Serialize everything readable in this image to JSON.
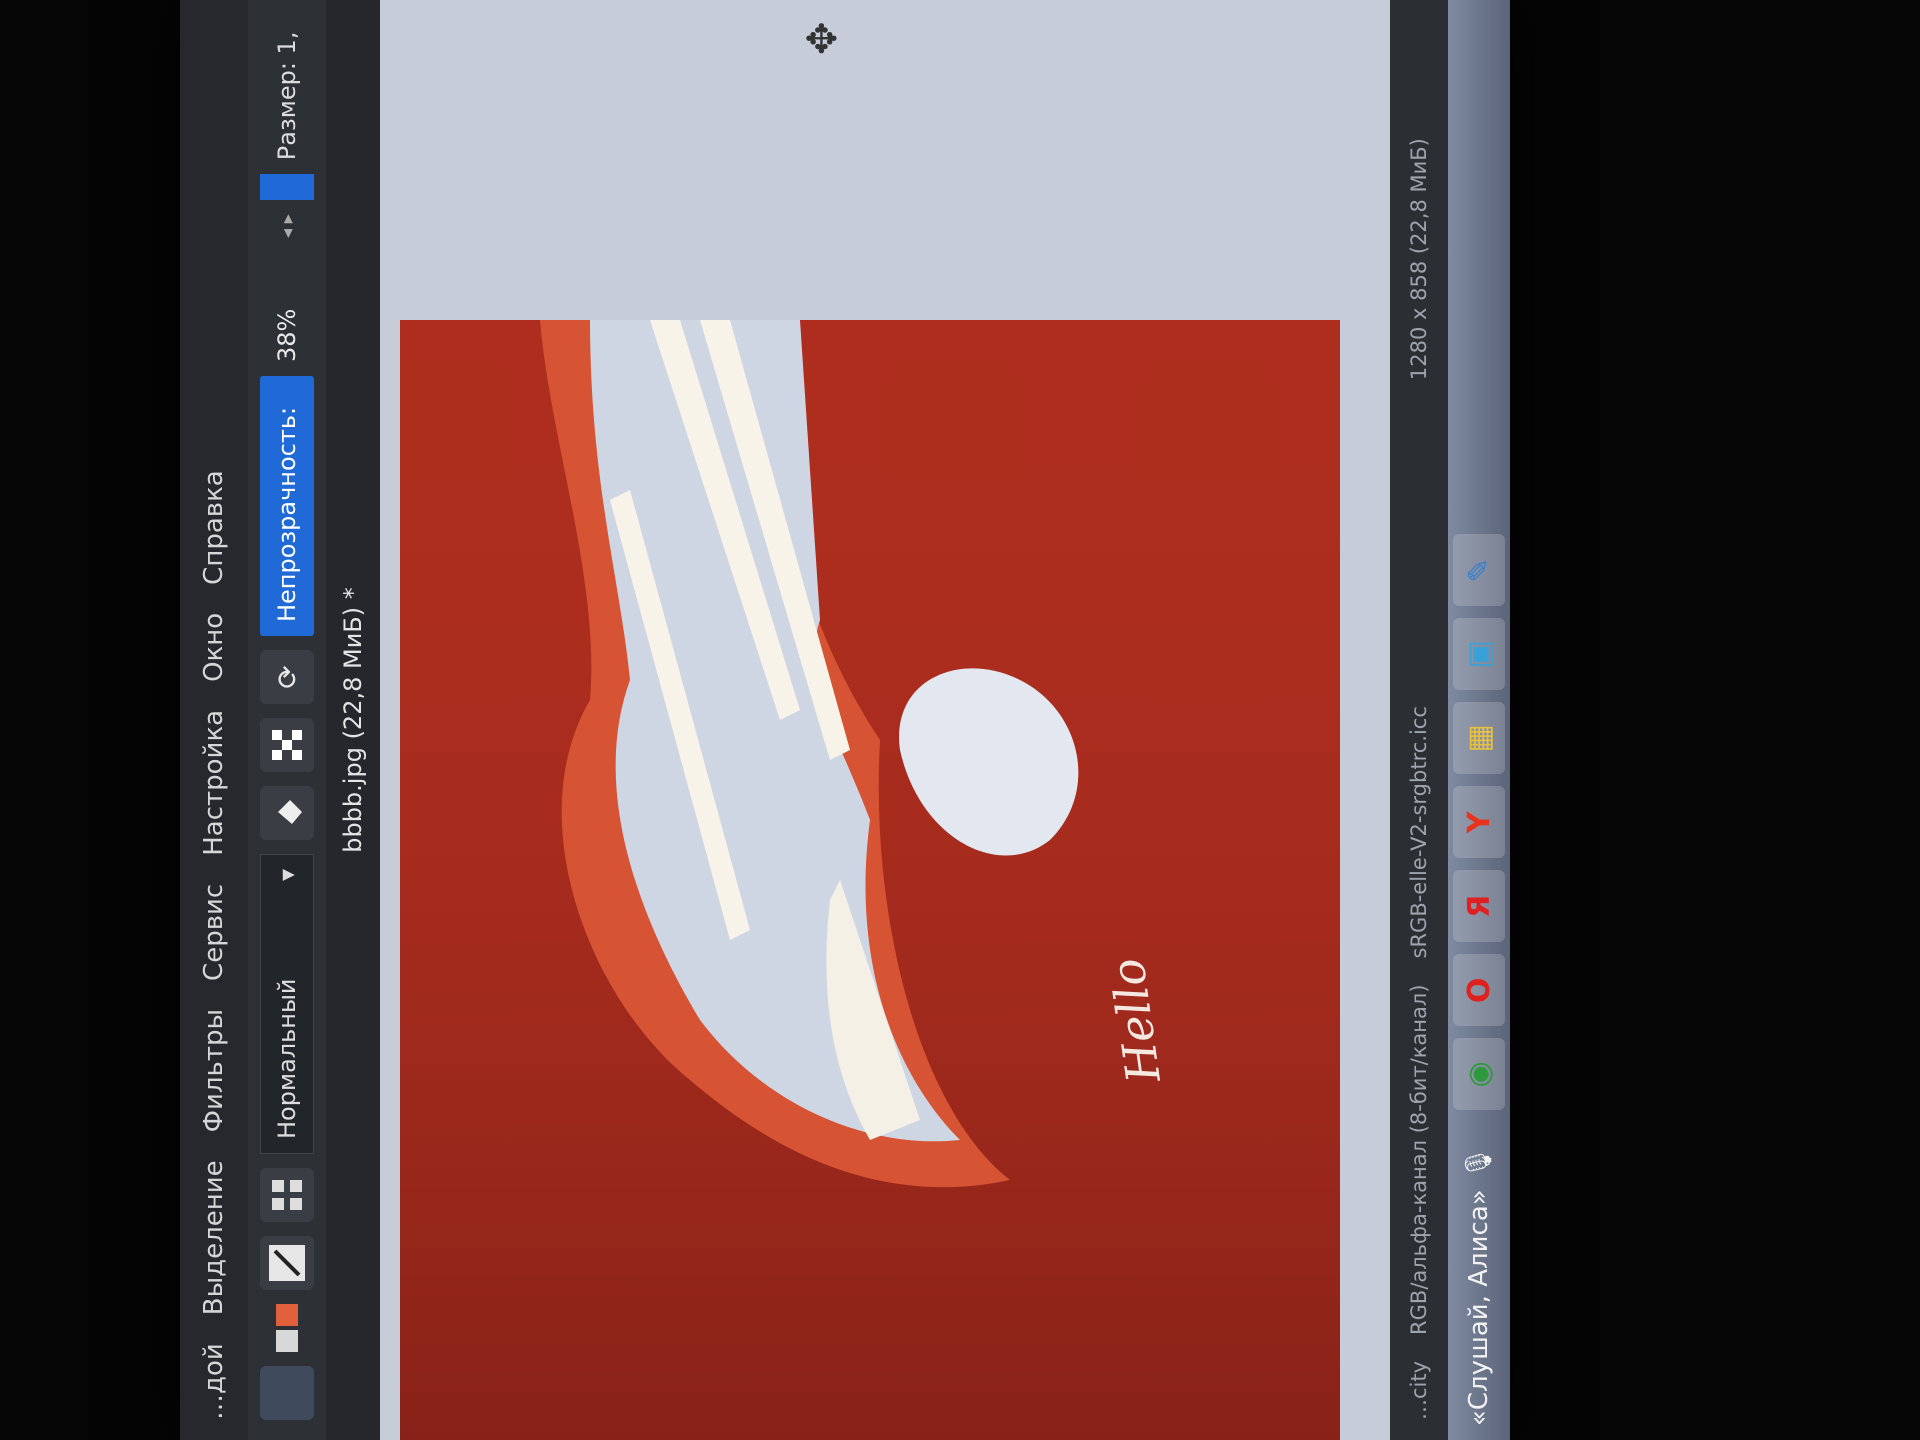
{
  "menu": {
    "items": [
      "…дой",
      "Выделение",
      "Фильтры",
      "Сервис",
      "Настройка",
      "Окно",
      "Справка"
    ]
  },
  "toolbar": {
    "mode": "Нормальный",
    "opacity_label": "Непрозрачность",
    "opacity_value": "38%",
    "size_label": "Размер: 1,"
  },
  "document": {
    "title": "bbbb.jpg (22,8 МиБ) *"
  },
  "canvas": {
    "text": "Hello",
    "colors": {
      "background": "#a82a1c",
      "accent": "#e0603c",
      "stroke_light": "#dde3ee",
      "stroke_white": "#f7f3e8"
    }
  },
  "status": {
    "colorspace": "RGB/альфа-канал (8-бит/канал)",
    "profile": "sRGB-elle-V2-srgbtrc.icc",
    "dimensions": "1280 x 858 (22,8 МиБ)",
    "left_fragment": "…city"
  },
  "taskbar": {
    "assistant": "«Слушай, Алиса»",
    "apps": [
      "chrome-icon",
      "opera-icon",
      "yandex-icon",
      "yandex-browser-icon",
      "file-manager-icon",
      "photos-icon",
      "krita-icon"
    ]
  }
}
